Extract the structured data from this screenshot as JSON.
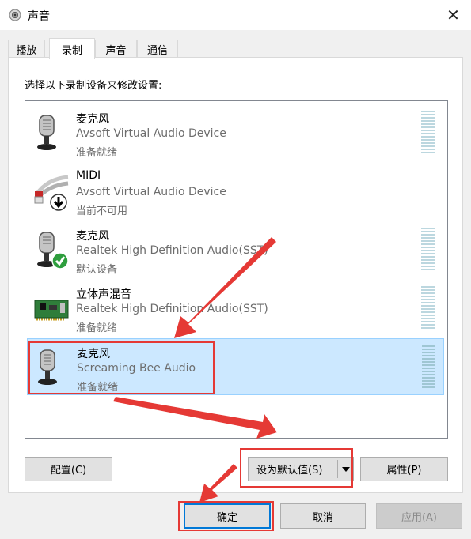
{
  "window": {
    "title": "声音",
    "close_glyph": "✕"
  },
  "tabs": [
    {
      "label": "播放"
    },
    {
      "label": "录制"
    },
    {
      "label": "声音"
    },
    {
      "label": "通信"
    }
  ],
  "active_tab": "录制",
  "instruction": "选择以下录制设备来修改设置:",
  "devices": [
    {
      "name": "麦克风",
      "description": "Avsoft Virtual Audio Device",
      "status": "准备就绪",
      "icon": "microphone-icon"
    },
    {
      "name": "MIDI",
      "description": "Avsoft Virtual Audio Device",
      "status": "当前不可用",
      "icon": "audio-cable-icon"
    },
    {
      "name": "麦克风",
      "description": "Realtek High Definition Audio(SST)",
      "status": "默认设备",
      "icon": "microphone-default-icon"
    },
    {
      "name": "立体声混音",
      "description": "Realtek High Definition Audio(SST)",
      "status": "准备就绪",
      "icon": "sound-card-icon"
    },
    {
      "name": "麦克风",
      "description": "Screaming Bee Audio",
      "status": "准备就绪",
      "icon": "microphone-icon",
      "selected": true
    }
  ],
  "buttons": {
    "configure": "配置(C)",
    "set_default": "设为默认值(S)",
    "properties": "属性(P)",
    "ok": "确定",
    "cancel": "取消",
    "apply": "应用(A)"
  },
  "colors": {
    "highlight": "#e53935",
    "selection": "#cce8ff",
    "default_button_border": "#0078d7"
  }
}
